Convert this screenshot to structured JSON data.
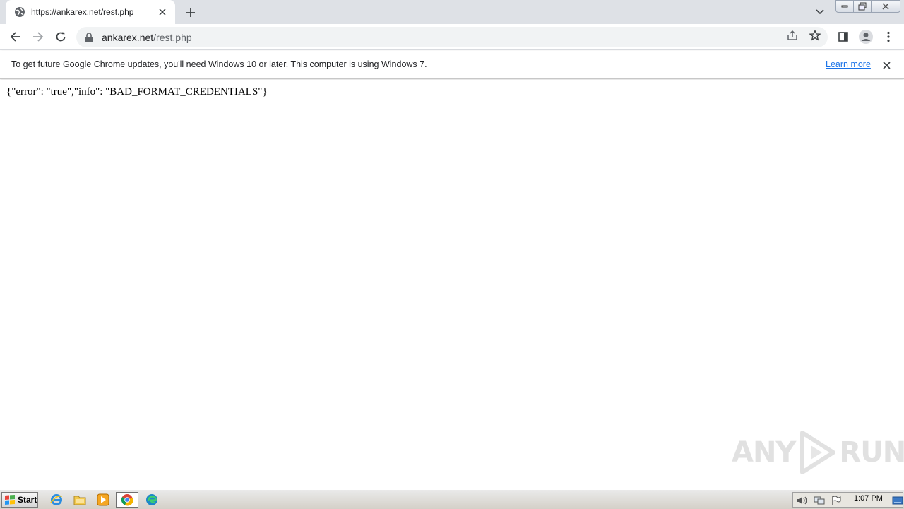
{
  "browser": {
    "tab": {
      "title": "https://ankarex.net/rest.php",
      "icon": "globe-icon"
    },
    "address_bar": {
      "host": "ankarex.net",
      "path": "/rest.php"
    }
  },
  "infobar": {
    "message": "To get future Google Chrome updates, you'll need Windows 10 or later. This computer is using Windows 7.",
    "link_label": "Learn more"
  },
  "page": {
    "body_text": "{\"error\": \"true\",\"info\": \"BAD_FORMAT_CREDENTIALS\"}"
  },
  "watermark": {
    "left": "ANY",
    "right": "RUN"
  },
  "taskbar": {
    "start_label": "Start",
    "clock": "1:07 PM"
  },
  "colors": {
    "tabstrip": "#dee1e6",
    "omnibox": "#f1f3f4",
    "link": "#1a73e8",
    "taskbar": "#d4d0c8"
  }
}
